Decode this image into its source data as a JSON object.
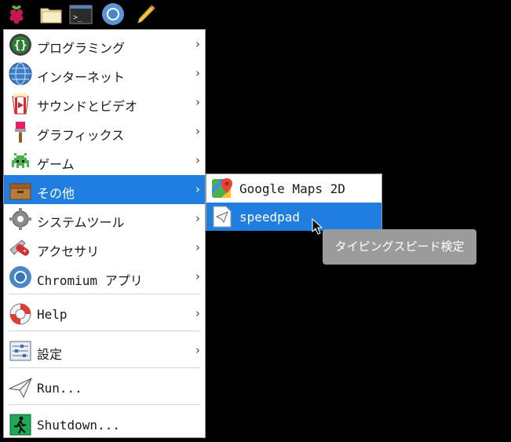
{
  "menu": {
    "items": [
      {
        "label": "プログラミング",
        "icon": "braces-icon",
        "has_submenu": true
      },
      {
        "label": "インターネット",
        "icon": "globe-icon",
        "has_submenu": true
      },
      {
        "label": "サウンドとビデオ",
        "icon": "popcorn-icon",
        "has_submenu": true
      },
      {
        "label": "グラフィックス",
        "icon": "paintbrush-icon",
        "has_submenu": true
      },
      {
        "label": "ゲーム",
        "icon": "space-invader-icon",
        "has_submenu": true
      },
      {
        "label": "その他",
        "icon": "box-icon",
        "has_submenu": true,
        "selected": true
      },
      {
        "label": "システムツール",
        "icon": "gear-icon",
        "has_submenu": true
      },
      {
        "label": "アクセサリ",
        "icon": "swiss-knife-icon",
        "has_submenu": true
      },
      {
        "label": "Chromium アプリ",
        "icon": "chromium-icon",
        "has_submenu": true
      },
      {
        "label": "Help",
        "icon": "lifebuoy-icon",
        "has_submenu": true
      },
      {
        "label": "設定",
        "icon": "settings-panel-icon",
        "has_submenu": true
      },
      {
        "label": "Run...",
        "icon": "paper-plane-icon",
        "has_submenu": false
      },
      {
        "label": "Shutdown...",
        "icon": "exit-icon",
        "has_submenu": false
      }
    ],
    "submenu_arrow": "›"
  },
  "submenu": {
    "items": [
      {
        "label": "Google Maps 2D",
        "icon": "google-maps-icon"
      },
      {
        "label": "speedpad",
        "icon": "speedpad-icon",
        "selected": true
      }
    ]
  },
  "tooltip": {
    "text": "タイピングスピード検定"
  },
  "colors": {
    "highlight": "#1f7ee0",
    "tooltip_bg": "#9b9b9b",
    "background": "#000000"
  }
}
